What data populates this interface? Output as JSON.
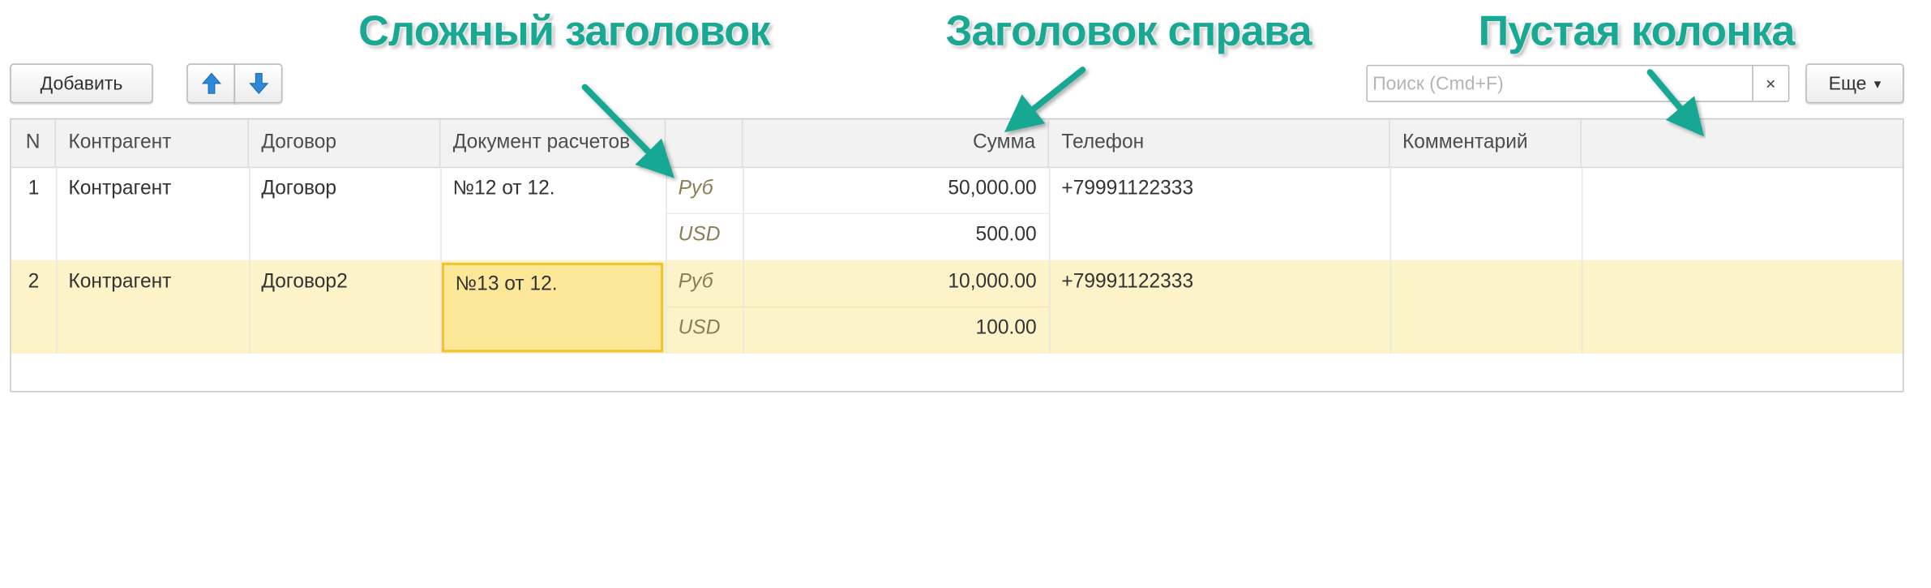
{
  "toolbar": {
    "add_label": "Добавить",
    "up_icon": "arrow-up-icon",
    "down_icon": "arrow-down-icon",
    "search_placeholder": "Поиск (Cmd+F)",
    "clear_glyph": "×",
    "more_label": "Еще",
    "more_glyph": "▾"
  },
  "annotations": {
    "complex_header": "Сложный заголовок",
    "right_header": "Заголовок справа",
    "empty_column": "Пустая колонка"
  },
  "colors": {
    "annotation": "#19a893",
    "selected_row": "#fdf3c8",
    "focused_cell": "#fde89a",
    "focus_border": "#f3c22c",
    "arrow_icon": "#2d8ad6"
  },
  "table": {
    "columns": [
      "N",
      "Контрагент",
      "Договор",
      "Документ расчетов",
      "",
      "Сумма",
      "Телефон",
      "Комментарий",
      ""
    ],
    "rows": [
      {
        "n": "1",
        "counterparty": "Контрагент",
        "contract": "Договор",
        "document": "№12 от 12.",
        "currency1": "Руб",
        "sum1": "50,000.00",
        "currency2": "USD",
        "sum2": "500.00",
        "phone": "+79991122333",
        "comment": ""
      },
      {
        "n": "2",
        "counterparty": "Контрагент",
        "contract": "Договор2",
        "document": "№13 от 12.",
        "currency1": "Руб",
        "sum1": "10,000.00",
        "currency2": "USD",
        "sum2": "100.00",
        "phone": "+79991122333",
        "comment": ""
      }
    ]
  }
}
